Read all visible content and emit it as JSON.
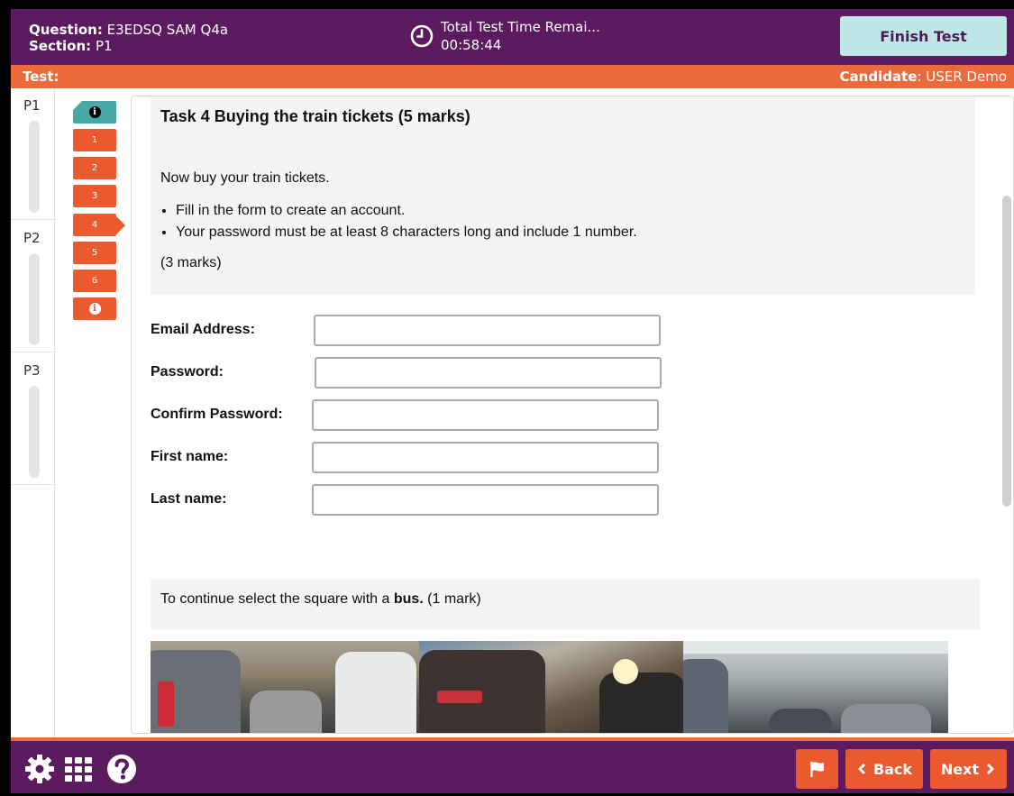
{
  "header": {
    "question_label": "Question:",
    "question_value": " E3EDSQ SAM Q4a",
    "section_label": "Section:",
    "section_value": " P1",
    "timer_title": "Total Test Time Remai...",
    "timer_value": "00:58:44",
    "finish_label": "Finish Test"
  },
  "subbar": {
    "test_label": "Test:",
    "candidate_label": "Candidate",
    "candidate_value": ": USER Demo"
  },
  "sections": [
    "P1",
    "P2",
    "P3"
  ],
  "questions": [
    "1",
    "2",
    "3",
    "4",
    "5",
    "6"
  ],
  "current_question": "4",
  "task": {
    "title": "Task 4 Buying the train tickets (5 marks)",
    "intro": "Now buy your train tickets.",
    "bullets": [
      "Fill in the form to create an account.",
      "Your password must be at least 8 characters long and include 1 number."
    ],
    "marks": "(3 marks)"
  },
  "form": {
    "email_label": "Email Address:",
    "password_label": "Password:",
    "confirm_label": "Confirm Password:",
    "first_label": "First name:",
    "last_label": "Last name:"
  },
  "captcha": {
    "prefix": "To continue select the square with a ",
    "keyword": "bus.",
    "suffix": " (1 mark)"
  },
  "footer": {
    "back_label": "Back",
    "next_label": "Next"
  },
  "colors": {
    "header_purple": "#5c1a5f",
    "accent_orange": "#eb5a2e",
    "teal": "#49a7a6"
  },
  "icons": [
    "clock-icon",
    "gear-icon",
    "grid-icon",
    "help-icon",
    "flag-icon",
    "chevron-left-icon",
    "chevron-right-icon",
    "info-icon"
  ]
}
